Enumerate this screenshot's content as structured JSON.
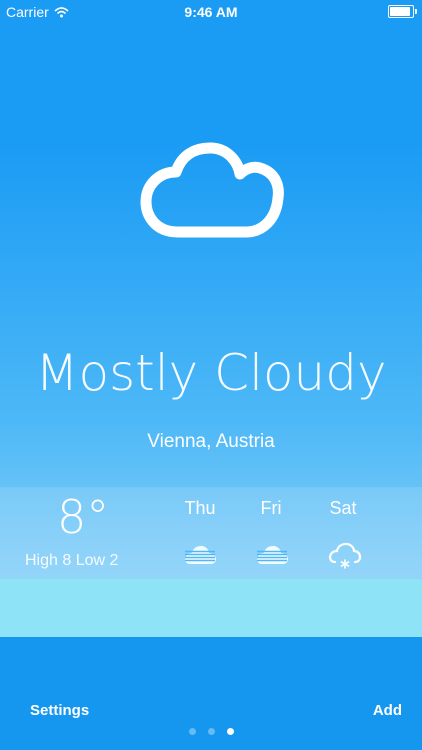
{
  "status_bar": {
    "carrier": "Carrier",
    "time": "9:46 AM",
    "battery_level": 1.0
  },
  "weather": {
    "condition": "Mostly Cloudy",
    "condition_icon": "cloud-icon",
    "location": "Vienna, Austria",
    "current_temp": "8°",
    "high_low": "High 8  Low 2"
  },
  "forecast": [
    {
      "day": "Thu",
      "icon": "cloudy-icon"
    },
    {
      "day": "Fri",
      "icon": "cloudy-icon"
    },
    {
      "day": "Sat",
      "icon": "snow-icon"
    }
  ],
  "toolbar": {
    "settings_label": "Settings",
    "add_label": "Add"
  },
  "pager": {
    "pages": 3,
    "current": 3
  },
  "colors": {
    "sky_top": "#1a9bf4",
    "sky_bottom": "#8fd6f8",
    "bottom_band": "#1597ef"
  }
}
